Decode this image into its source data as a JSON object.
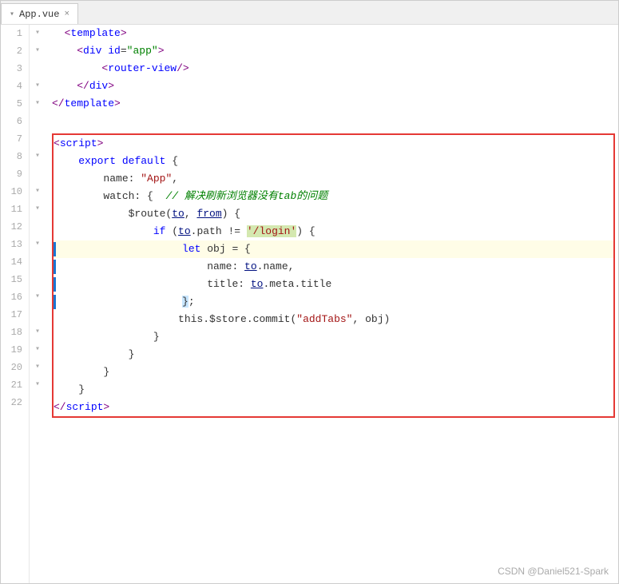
{
  "tab": {
    "arrow": "▾",
    "filename": "App.vue",
    "close": "×"
  },
  "watermark": "CSDN @Daniel521-Spark",
  "lines": [
    {
      "num": 1,
      "fold": "▾",
      "indent": 0,
      "tokens": [
        {
          "type": "default",
          "text": "  "
        },
        {
          "type": "bracket",
          "text": "<"
        },
        {
          "type": "tag",
          "text": "template"
        },
        {
          "type": "bracket",
          "text": ">"
        }
      ]
    },
    {
      "num": 2,
      "fold": "▾",
      "indent": 0,
      "tokens": [
        {
          "type": "default",
          "text": "    "
        },
        {
          "type": "bracket",
          "text": "<"
        },
        {
          "type": "tag",
          "text": "div"
        },
        {
          "type": "default",
          "text": " "
        },
        {
          "type": "attr",
          "text": "id"
        },
        {
          "type": "default",
          "text": "="
        },
        {
          "type": "attrval",
          "text": "\"app\""
        },
        {
          "type": "bracket",
          "text": ">"
        }
      ]
    },
    {
      "num": 3,
      "fold": "",
      "indent": 0,
      "tokens": [
        {
          "type": "default",
          "text": "        "
        },
        {
          "type": "bracket",
          "text": "<"
        },
        {
          "type": "tag",
          "text": "router-view"
        },
        {
          "type": "bracket",
          "text": "/>"
        }
      ]
    },
    {
      "num": 4,
      "fold": "▾",
      "indent": 0,
      "tokens": [
        {
          "type": "default",
          "text": "    "
        },
        {
          "type": "bracket",
          "text": "</"
        },
        {
          "type": "tag",
          "text": "div"
        },
        {
          "type": "bracket",
          "text": ">"
        }
      ]
    },
    {
      "num": 5,
      "fold": "▾",
      "indent": 0,
      "tokens": [
        {
          "type": "bracket",
          "text": "</"
        },
        {
          "type": "tag",
          "text": "template"
        },
        {
          "type": "bracket",
          "text": ">"
        }
      ]
    },
    {
      "num": 6,
      "fold": "",
      "indent": 0,
      "tokens": []
    },
    {
      "num": 7,
      "fold": "",
      "indent": 0,
      "inRedBox": true,
      "tokens": [
        {
          "type": "bracket",
          "text": "<"
        },
        {
          "type": "tag",
          "text": "script"
        },
        {
          "type": "bracket",
          "text": ">"
        }
      ]
    },
    {
      "num": 8,
      "fold": "▾",
      "indent": 0,
      "inRedBox": true,
      "tokens": [
        {
          "type": "default",
          "text": "    "
        },
        {
          "type": "kw",
          "text": "export"
        },
        {
          "type": "default",
          "text": " "
        },
        {
          "type": "kw",
          "text": "default"
        },
        {
          "type": "default",
          "text": " {"
        }
      ]
    },
    {
      "num": 9,
      "fold": "",
      "indent": 0,
      "inRedBox": true,
      "tokens": [
        {
          "type": "default",
          "text": "        "
        },
        {
          "type": "default",
          "text": "name: "
        },
        {
          "type": "str",
          "text": "\"App\""
        },
        {
          "type": "default",
          "text": ","
        }
      ]
    },
    {
      "num": 10,
      "fold": "▾",
      "indent": 0,
      "inRedBox": true,
      "tokens": [
        {
          "type": "default",
          "text": "        "
        },
        {
          "type": "default",
          "text": "watch: {  "
        },
        {
          "type": "comment",
          "text": "// 解决刷新浏览器没有tab的问题"
        }
      ]
    },
    {
      "num": 11,
      "fold": "▾",
      "indent": 0,
      "inRedBox": true,
      "tokens": [
        {
          "type": "default",
          "text": "            "
        },
        {
          "type": "default",
          "text": "$route("
        },
        {
          "type": "to",
          "text": "to"
        },
        {
          "type": "default",
          "text": ", "
        },
        {
          "type": "from",
          "text": "from"
        },
        {
          "type": "default",
          "text": ") {"
        }
      ]
    },
    {
      "num": 12,
      "fold": "",
      "indent": 0,
      "inRedBox": true,
      "tokens": [
        {
          "type": "default",
          "text": "                "
        },
        {
          "type": "kw",
          "text": "if"
        },
        {
          "type": "default",
          "text": " ("
        },
        {
          "type": "to",
          "text": "to"
        },
        {
          "type": "default",
          "text": ".path != "
        },
        {
          "type": "strhl",
          "text": "'/login'"
        },
        {
          "type": "default",
          "text": ") {"
        }
      ]
    },
    {
      "num": 13,
      "fold": "▾",
      "indent": 0,
      "inRedBox": true,
      "highlighted": true,
      "hasBlueBar": true,
      "tokens": [
        {
          "type": "default",
          "text": "                    "
        },
        {
          "type": "kw",
          "text": "let"
        },
        {
          "type": "default",
          "text": " obj = {"
        }
      ]
    },
    {
      "num": 14,
      "fold": "",
      "indent": 0,
      "inRedBox": true,
      "hasBlueBar": true,
      "tokens": [
        {
          "type": "default",
          "text": "                        "
        },
        {
          "type": "default",
          "text": "name: "
        },
        {
          "type": "to",
          "text": "to"
        },
        {
          "type": "default",
          "text": ".name,"
        }
      ]
    },
    {
      "num": 15,
      "fold": "",
      "indent": 0,
      "inRedBox": true,
      "hasBlueBar": true,
      "tokens": [
        {
          "type": "default",
          "text": "                        "
        },
        {
          "type": "default",
          "text": "title: "
        },
        {
          "type": "to",
          "text": "to"
        },
        {
          "type": "default",
          "text": ".meta.title"
        }
      ]
    },
    {
      "num": 16,
      "fold": "▾",
      "indent": 0,
      "inRedBox": true,
      "hasBlueBar": true,
      "tokens": [
        {
          "type": "default",
          "text": "                    "
        },
        {
          "type": "hlbrace",
          "text": "}"
        },
        {
          "type": "default",
          "text": ";"
        }
      ]
    },
    {
      "num": 17,
      "fold": "",
      "indent": 0,
      "inRedBox": true,
      "tokens": [
        {
          "type": "default",
          "text": "                    "
        },
        {
          "type": "default",
          "text": "this.$store.commit("
        },
        {
          "type": "str",
          "text": "\"addTabs\""
        },
        {
          "type": "default",
          "text": ", obj)"
        }
      ]
    },
    {
      "num": 18,
      "fold": "▾",
      "indent": 0,
      "inRedBox": true,
      "tokens": [
        {
          "type": "default",
          "text": "                "
        },
        {
          "type": "default",
          "text": "}"
        }
      ]
    },
    {
      "num": 19,
      "fold": "▾",
      "indent": 0,
      "inRedBox": true,
      "tokens": [
        {
          "type": "default",
          "text": "            "
        },
        {
          "type": "default",
          "text": "}"
        }
      ]
    },
    {
      "num": 20,
      "fold": "▾",
      "indent": 0,
      "inRedBox": true,
      "tokens": [
        {
          "type": "default",
          "text": "        "
        },
        {
          "type": "default",
          "text": "}"
        }
      ]
    },
    {
      "num": 21,
      "fold": "▾",
      "indent": 0,
      "inRedBox": true,
      "tokens": [
        {
          "type": "default",
          "text": "    "
        },
        {
          "type": "default",
          "text": "}"
        }
      ]
    },
    {
      "num": 22,
      "fold": "",
      "indent": 0,
      "inRedBox": true,
      "tokens": [
        {
          "type": "bracket",
          "text": "</"
        },
        {
          "type": "tag",
          "text": "script"
        },
        {
          "type": "bracket",
          "text": ">"
        }
      ]
    }
  ]
}
